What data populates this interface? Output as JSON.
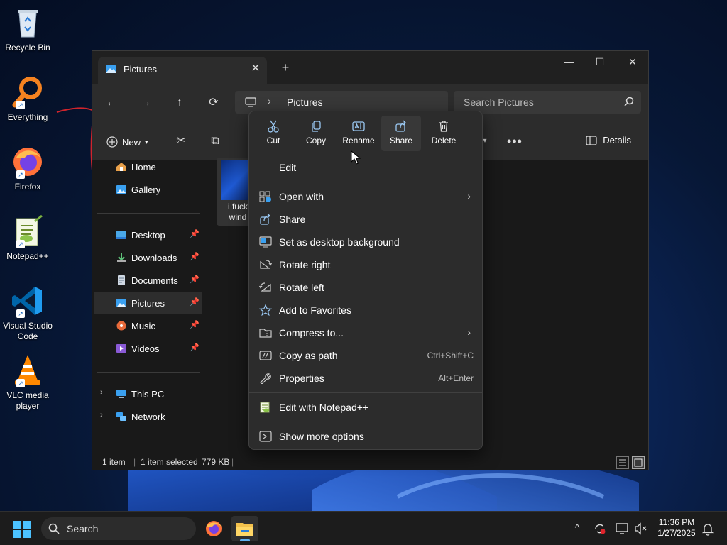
{
  "desktop": {
    "icons": [
      {
        "label": "Recycle Bin",
        "icon": "recycle-bin-icon"
      },
      {
        "label": "Everything",
        "icon": "everything-search-icon"
      },
      {
        "label": "Firefox",
        "icon": "firefox-icon"
      },
      {
        "label": "Notepad++",
        "icon": "notepadpp-icon"
      },
      {
        "label": "Visual Studio Code",
        "icon": "vscode-icon"
      },
      {
        "label": "VLC media player",
        "icon": "vlc-icon"
      }
    ]
  },
  "window": {
    "tab_title": "Pictures",
    "close_tab_glyph": "✕",
    "new_tab_glyph": "+",
    "controls": {
      "minimize": "—",
      "maximize": "☐",
      "close": "✕"
    }
  },
  "navbar": {
    "back": "←",
    "forward": "→",
    "up": "↑",
    "refresh": "⟳",
    "breadcrumb": [
      "Pictures"
    ],
    "search_placeholder": "Search Pictures"
  },
  "commandbar": {
    "new_label": "New",
    "details_label": "Details"
  },
  "sidebar": {
    "groups": [
      [
        {
          "label": "Home",
          "icon": "home-icon"
        },
        {
          "label": "Gallery",
          "icon": "gallery-icon"
        }
      ],
      [
        {
          "label": "Desktop",
          "icon": "desktop-folder-icon",
          "pinned": true
        },
        {
          "label": "Downloads",
          "icon": "downloads-icon",
          "pinned": true
        },
        {
          "label": "Documents",
          "icon": "documents-icon",
          "pinned": true
        },
        {
          "label": "Pictures",
          "icon": "pictures-icon",
          "pinned": true,
          "selected": true
        },
        {
          "label": "Music",
          "icon": "music-icon",
          "pinned": true
        },
        {
          "label": "Videos",
          "icon": "videos-icon",
          "pinned": true
        }
      ],
      [
        {
          "label": "This PC",
          "icon": "this-pc-icon",
          "expandable": true
        },
        {
          "label": "Network",
          "icon": "network-icon",
          "expandable": true
        }
      ]
    ],
    "pin_glyph": "📌",
    "expand_glyph": "›"
  },
  "content": {
    "files": [
      {
        "name_line1": "i fuck",
        "name_line2": "wind"
      }
    ]
  },
  "statusbar": {
    "count": "1 item",
    "selected": "1 item selected",
    "size": "779 KB"
  },
  "context_menu": {
    "quick_actions": [
      {
        "label": "Cut",
        "icon": "scissors-icon"
      },
      {
        "label": "Copy",
        "icon": "copy-icon"
      },
      {
        "label": "Rename",
        "icon": "rename-icon"
      },
      {
        "label": "Share",
        "icon": "share-icon"
      },
      {
        "label": "Delete",
        "icon": "trash-icon"
      }
    ],
    "items": [
      {
        "label": "Edit"
      },
      {
        "label": "Open with",
        "submenu": true,
        "icon": "open-with-icon"
      },
      {
        "label": "Share",
        "icon": "share-icon"
      },
      {
        "label": "Set as desktop background",
        "icon": "wallpaper-icon"
      },
      {
        "label": "Rotate right",
        "icon": "rotate-right-icon"
      },
      {
        "label": "Rotate left",
        "icon": "rotate-left-icon"
      },
      {
        "label": "Add to Favorites",
        "icon": "star-icon"
      },
      {
        "label": "Compress to...",
        "submenu": true,
        "icon": "zip-folder-icon"
      },
      {
        "label": "Copy as path",
        "shortcut": "Ctrl+Shift+C",
        "icon": "copy-path-icon"
      },
      {
        "label": "Properties",
        "shortcut": "Alt+Enter",
        "icon": "wrench-icon"
      },
      {
        "label": "Edit with Notepad++",
        "icon": "notepadpp-icon"
      },
      {
        "label": "Show more options",
        "icon": "more-options-icon"
      }
    ],
    "submenu_glyph": "›"
  },
  "taskbar": {
    "search_label": "Search",
    "clock_time": "11:36 PM",
    "clock_date": "1/27/2025"
  },
  "colors": {
    "accent": "#5fb2f2",
    "window_bg": "#191919",
    "chrome_bg": "#2c2c2c",
    "taskbar_bg": "#1c1c1c"
  }
}
